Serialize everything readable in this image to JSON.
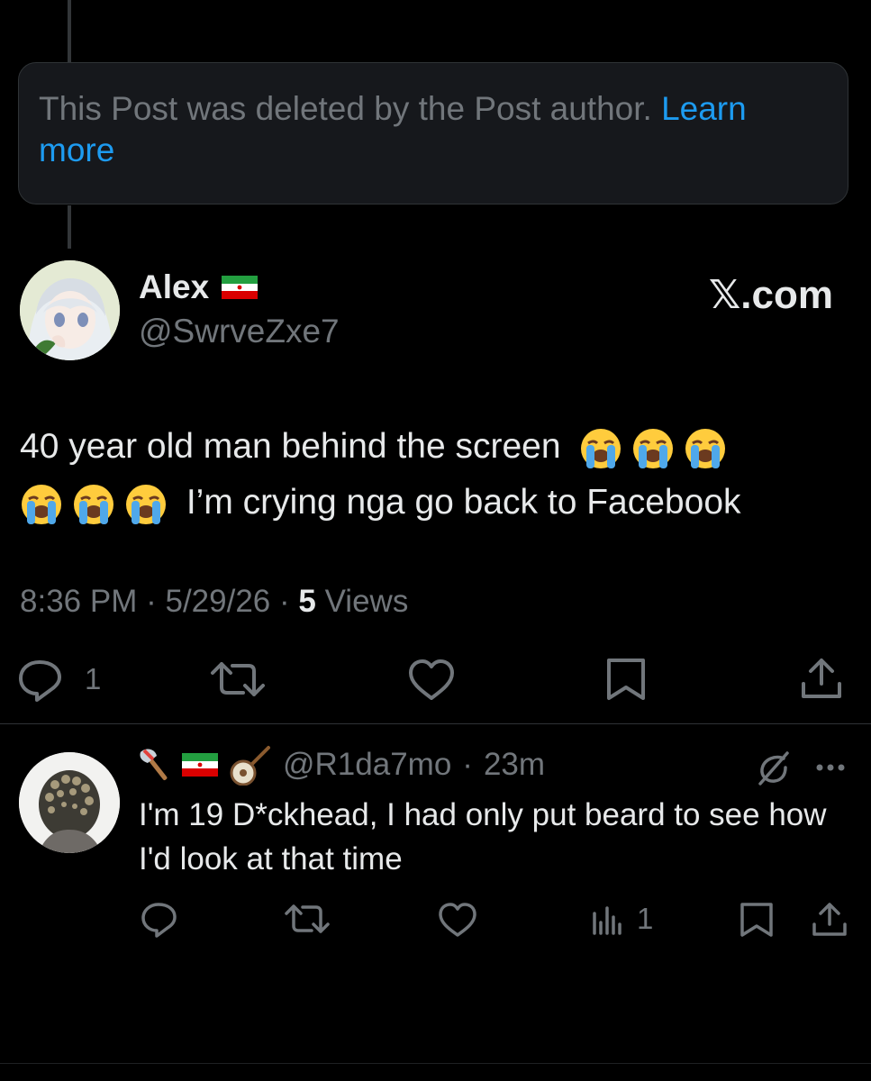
{
  "deleted_notice": {
    "text": "This Post was deleted by the Post author.",
    "link": "Learn more"
  },
  "post": {
    "author_name": "Alex",
    "author_flag": "iran-flag-icon",
    "handle": "@SwrveZxe7",
    "brand": "𝕏.com",
    "text_line1": "40 year old man behind the screen",
    "text_line2": "I’m crying nga go back to Facebook",
    "emoji": "loudly-crying-face-icon",
    "time": "8:36 PM",
    "date": "5/29/26",
    "views_count": "5",
    "views_label": "Views",
    "reply_count": "1",
    "meta_sep": "·"
  },
  "reply": {
    "handle": "@R1da7mo",
    "sep": "·",
    "age": "23m",
    "text": "I'm 19 D*ckhead, I had only put beard to see how I'd look at that time",
    "views_count": "1",
    "badges": [
      "axe-icon",
      "iran-flag-icon",
      "banjo-icon"
    ]
  },
  "colors": {
    "background": "#000000",
    "text": "#e7e9ea",
    "secondary": "#71767b",
    "link": "#1d9bf0",
    "border": "#2f3336"
  }
}
